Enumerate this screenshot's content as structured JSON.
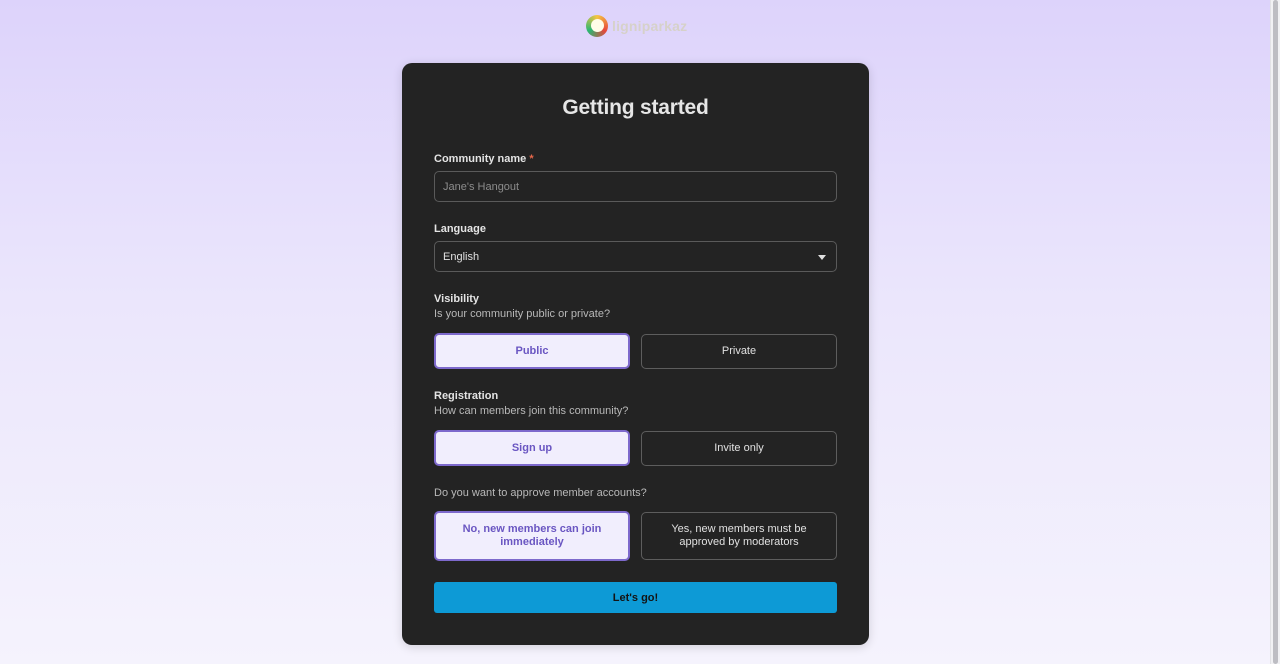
{
  "brand": {
    "logo_text": "ligniparkaz"
  },
  "form": {
    "title": "Getting started",
    "community_name": {
      "label": "Community name",
      "required_mark": "*",
      "placeholder": "Jane's Hangout",
      "value": ""
    },
    "language": {
      "label": "Language",
      "selected": "English"
    },
    "visibility": {
      "label": "Visibility",
      "hint": "Is your community public or private?",
      "options": [
        "Public",
        "Private"
      ],
      "selected": "Public"
    },
    "registration": {
      "label": "Registration",
      "hint": "How can members join this community?",
      "options": [
        "Sign up",
        "Invite only"
      ],
      "selected": "Sign up"
    },
    "approval": {
      "hint": "Do you want to approve member accounts?",
      "options": [
        "No, new members can join immediately",
        "Yes, new members must be approved by moderators"
      ],
      "selected": "No, new members can join immediately"
    },
    "submit_label": "Let's go!"
  },
  "colors": {
    "accent": "#7d69cc",
    "submit": "#0d9ad6",
    "card": "#232323",
    "required": "#e5674a"
  },
  "icons": {
    "logo": "brand-logo-icon",
    "dropdown": "chevron-down-icon"
  }
}
